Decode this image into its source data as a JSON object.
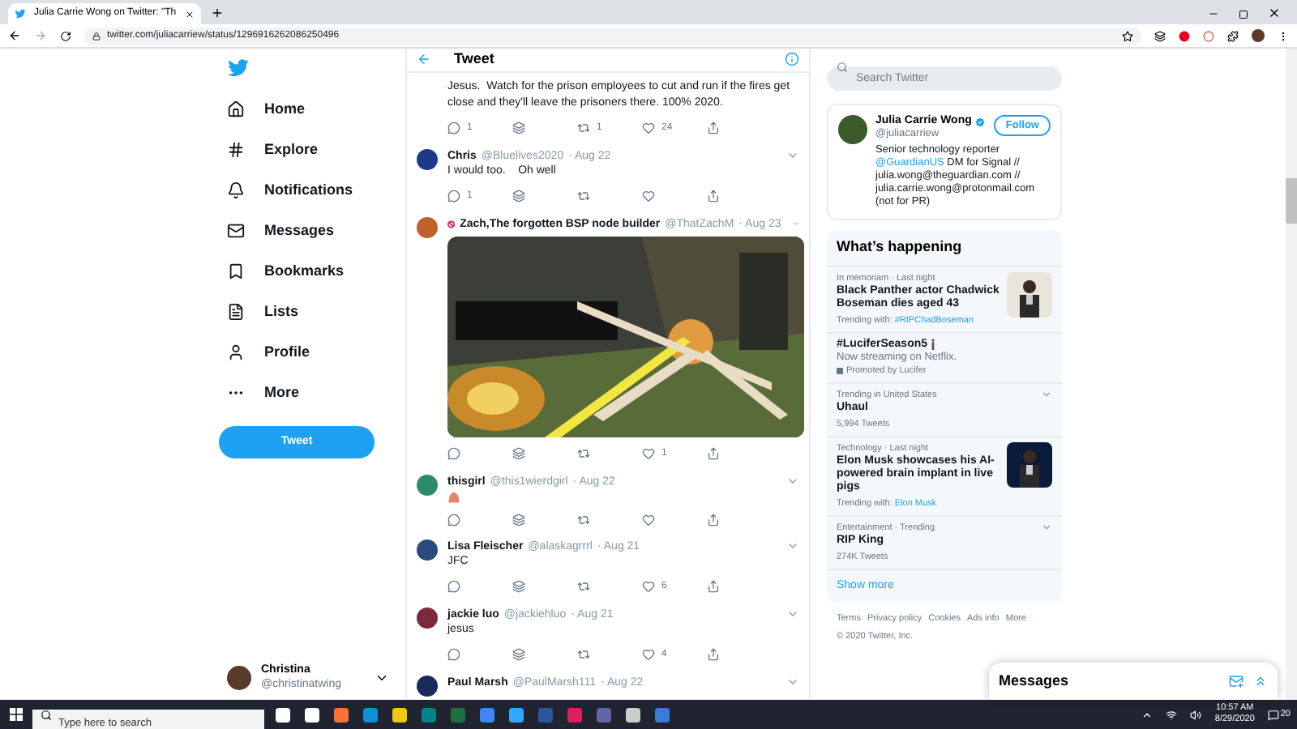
{
  "browser": {
    "tab_title": "Julia Carrie Wong on Twitter: \"Th",
    "url": "twitter.com/juliacarriew/status/1296916262086250496"
  },
  "sidebar": {
    "items": [
      {
        "label": "Home"
      },
      {
        "label": "Explore"
      },
      {
        "label": "Notifications"
      },
      {
        "label": "Messages"
      },
      {
        "label": "Bookmarks"
      },
      {
        "label": "Lists"
      },
      {
        "label": "Profile"
      },
      {
        "label": "More"
      }
    ],
    "tweet_button": "Tweet",
    "account": {
      "name": "Christina",
      "handle": "@christinatwing"
    }
  },
  "header": {
    "title": "Tweet"
  },
  "tweets": [
    {
      "text": "Jesus.  Watch for the prison employees to cut and run if the fires get close and they'll leave the prisoners there. 100% 2020.",
      "replies": "1",
      "retweets": "1",
      "likes": "24"
    },
    {
      "name": "Chris",
      "handle": "@Bluelives2020",
      "date": "· Aug 22",
      "text": "I would too.    Oh well",
      "replies": "1"
    },
    {
      "name": "Zach,The forgotten BSP node builder",
      "handle": "@ThatZachM",
      "date": "· Aug 23",
      "badge": true,
      "likes": "1"
    },
    {
      "name": "thisgirl",
      "handle": "@this1wierdgirl",
      "date": "· Aug 22",
      "emoji": true
    },
    {
      "name": "Lisa Fleischer",
      "handle": "@alaskagrrrl",
      "date": "· Aug 21",
      "text": "JFC",
      "likes": "6"
    },
    {
      "name": "jackie luo",
      "handle": "@jackiehluo",
      "date": "· Aug 21",
      "text": "jesus",
      "likes": "4"
    },
    {
      "name": "Paul Marsh",
      "handle": "@PaulMarsh111",
      "date": "· Aug 22"
    }
  ],
  "search": {
    "placeholder": "Search Twitter"
  },
  "person": {
    "name": "Julia Carrie Wong",
    "verified": true,
    "handle": "@juliacarriew",
    "follow": "Follow",
    "bio": [
      {
        "kind": "text",
        "text": "Senior technology reporter "
      },
      {
        "kind": "link",
        "text": "@GuardianUS"
      },
      {
        "kind": "text",
        "text": " DM for Signal // julia.wong@theguardian.com // julia.carrie.wong@protonmail.com (not for PR)"
      }
    ]
  },
  "trends": {
    "title": "What’s happening",
    "items": [
      {
        "context": "In memoriam · Last night",
        "title": "Black Panther actor Chadwick Boseman dies aged 43",
        "meta": "Trending with: ",
        "link": "#RIPChadBoseman",
        "picture": true
      },
      {
        "title": "#LuciferSeason5",
        "title_icon": true,
        "subtitle": "Now streaming on Netflix.",
        "promoted": "Promoted by Lucifer"
      },
      {
        "context": "Trending in United States",
        "title": "Uhaul",
        "meta": "5,994 Tweets",
        "menu": true
      },
      {
        "context": "Technology · Last night",
        "title": "Elon Musk showcases his AI-powered brain implant in live pigs",
        "meta": "Trending with: ",
        "link": "Elon Musk",
        "picture": true
      },
      {
        "context": "Entertainment · Trending",
        "title": "RIP King",
        "meta": "274K Tweets",
        "menu": true
      }
    ],
    "show_more": "Show more"
  },
  "footer": {
    "links": [
      "Terms",
      "Privacy policy",
      "Cookies",
      "Ads info",
      "More"
    ],
    "copyright": "© 2020 Twitter, Inc."
  },
  "messages": {
    "title": "Messages"
  },
  "taskbar": {
    "search_placeholder": "Type here to search",
    "time": "10:57 AM",
    "date": "8/29/2020",
    "notifications": "20"
  }
}
